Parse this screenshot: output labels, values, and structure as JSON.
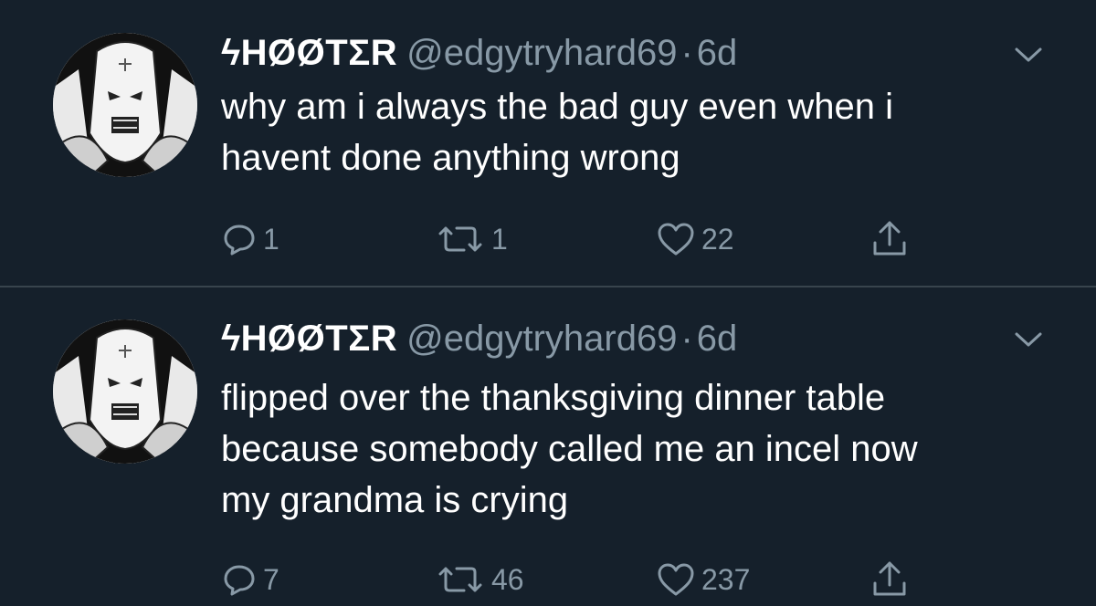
{
  "tweets": [
    {
      "name": "ϟHØØTΣR",
      "handle": "@edgytryhard69",
      "separator": "·",
      "time": "6d",
      "lines": [
        "why am i always the bad guy even when i",
        "havent done anything wrong"
      ],
      "replies": "1",
      "retweets": "1",
      "likes": "22"
    },
    {
      "name": "ϟHØØTΣR",
      "handle": "@edgytryhard69",
      "separator": "·",
      "time": "6d",
      "lines": [
        "flipped over the thanksgiving dinner table",
        "because somebody called me an incel now",
        "my grandma is crying"
      ],
      "replies": "7",
      "retweets": "46",
      "likes": "237"
    }
  ],
  "colors": {
    "background": "#15202b",
    "secondary_text": "#8899a6",
    "divider": "#38444d"
  },
  "icons": {
    "reply": "reply-icon",
    "retweet": "retweet-icon",
    "like": "heart-icon",
    "share": "share-icon",
    "menu": "chevron-down-icon"
  }
}
